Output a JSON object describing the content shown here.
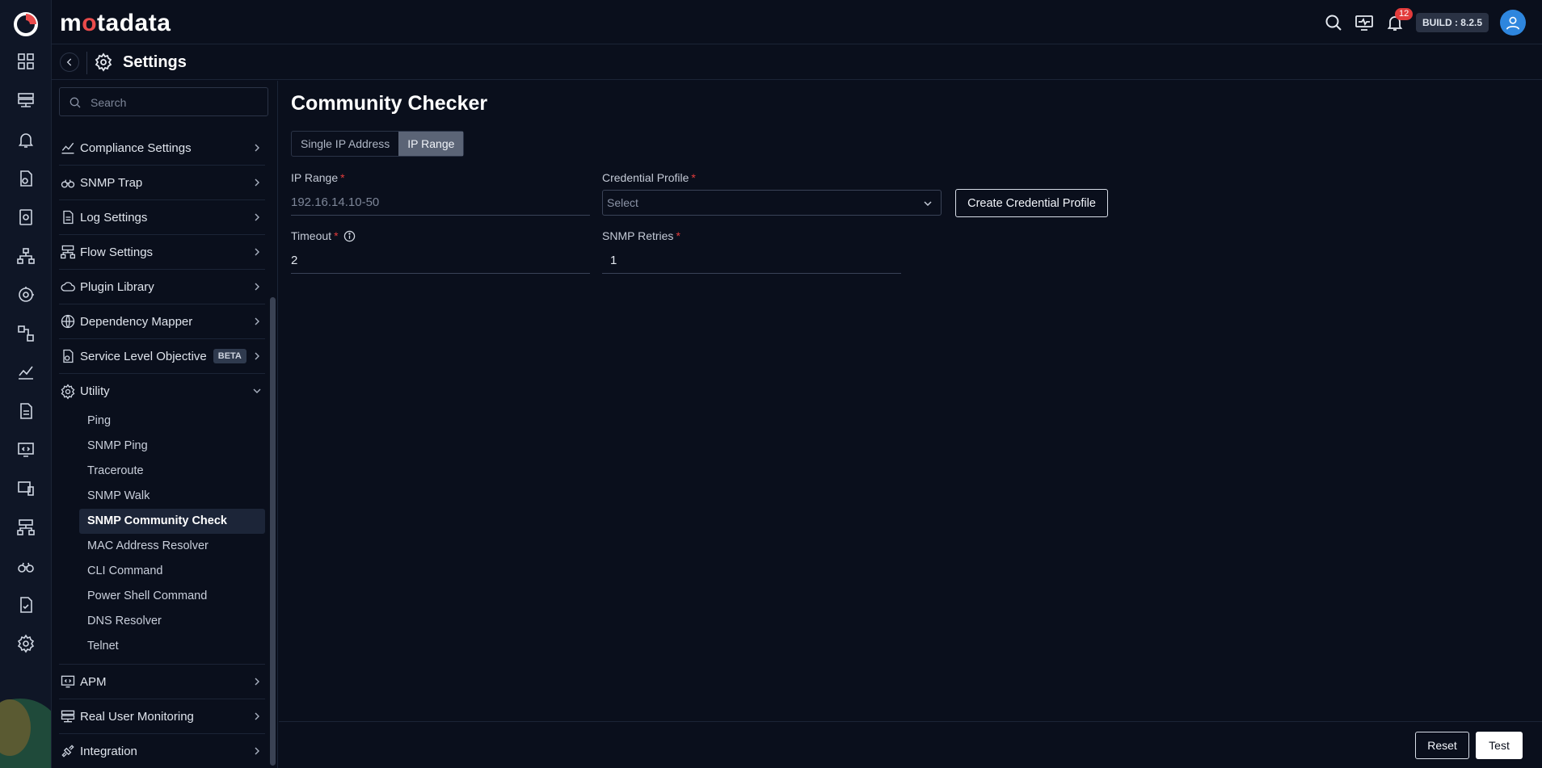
{
  "brand": {
    "text_pre": "m",
    "text_o": "o",
    "text_post": "tadata"
  },
  "topbar": {
    "notification_count": "12",
    "build": "BUILD : 8.2.5"
  },
  "header": {
    "title": "Settings"
  },
  "search": {
    "placeholder": "Search"
  },
  "rail": {
    "icons": [
      "dashboard-icon",
      "inventory-icon",
      "alert-bell-icon",
      "policy-icon",
      "report-icon",
      "topology-icon",
      "monitoring-icon",
      "workflow-icon",
      "metric-explorer-icon",
      "log-icon",
      "apm-icon",
      "device-icon",
      "network-icon",
      "binoculars-icon",
      "audit-icon",
      "settings-icon"
    ]
  },
  "sidebar": {
    "items": [
      {
        "label": "Compliance Settings",
        "icon": "chart-line-icon"
      },
      {
        "label": "SNMP Trap",
        "icon": "binoculars-icon"
      },
      {
        "label": "Log Settings",
        "icon": "document-icon"
      },
      {
        "label": "Flow Settings",
        "icon": "flow-icon"
      },
      {
        "label": "Plugin Library",
        "icon": "cloud-icon"
      },
      {
        "label": "Dependency Mapper",
        "icon": "globe-icon"
      },
      {
        "label": "Service Level Objective",
        "icon": "slo-icon",
        "badge": "BETA"
      },
      {
        "label": "Utility",
        "icon": "gear-cog-icon"
      }
    ],
    "utility_children": [
      "Ping",
      "SNMP Ping",
      "Traceroute",
      "SNMP Walk",
      "SNMP Community Check",
      "MAC Address Resolver",
      "CLI Command",
      "Power Shell Command",
      "DNS Resolver",
      "Telnet"
    ],
    "active_child": "SNMP Community Check",
    "items_after": [
      {
        "label": "APM",
        "icon": "monitor-code-icon"
      },
      {
        "label": "Real User Monitoring",
        "icon": "server-icon"
      },
      {
        "label": "Integration",
        "icon": "plug-icon"
      }
    ]
  },
  "main": {
    "title": "Community Checker",
    "tabs": [
      "Single IP Address",
      "IP Range"
    ],
    "active_tab": "IP Range",
    "fields": {
      "ip_range": {
        "label": "IP Range",
        "value": "192.16.14.10-50"
      },
      "credential_profile": {
        "label": "Credential Profile",
        "placeholder": "Select"
      },
      "timeout": {
        "label": "Timeout",
        "value": "2"
      },
      "snmp_retries": {
        "label": "SNMP Retries",
        "value": "1"
      }
    },
    "create_profile_button": "Create Credential Profile",
    "required_mark": "*"
  },
  "footer": {
    "reset": "Reset",
    "test": "Test"
  },
  "colors": {
    "background": "#0a0f1c",
    "required": "#e23b3b",
    "brand_accent": "#e94b4b"
  }
}
